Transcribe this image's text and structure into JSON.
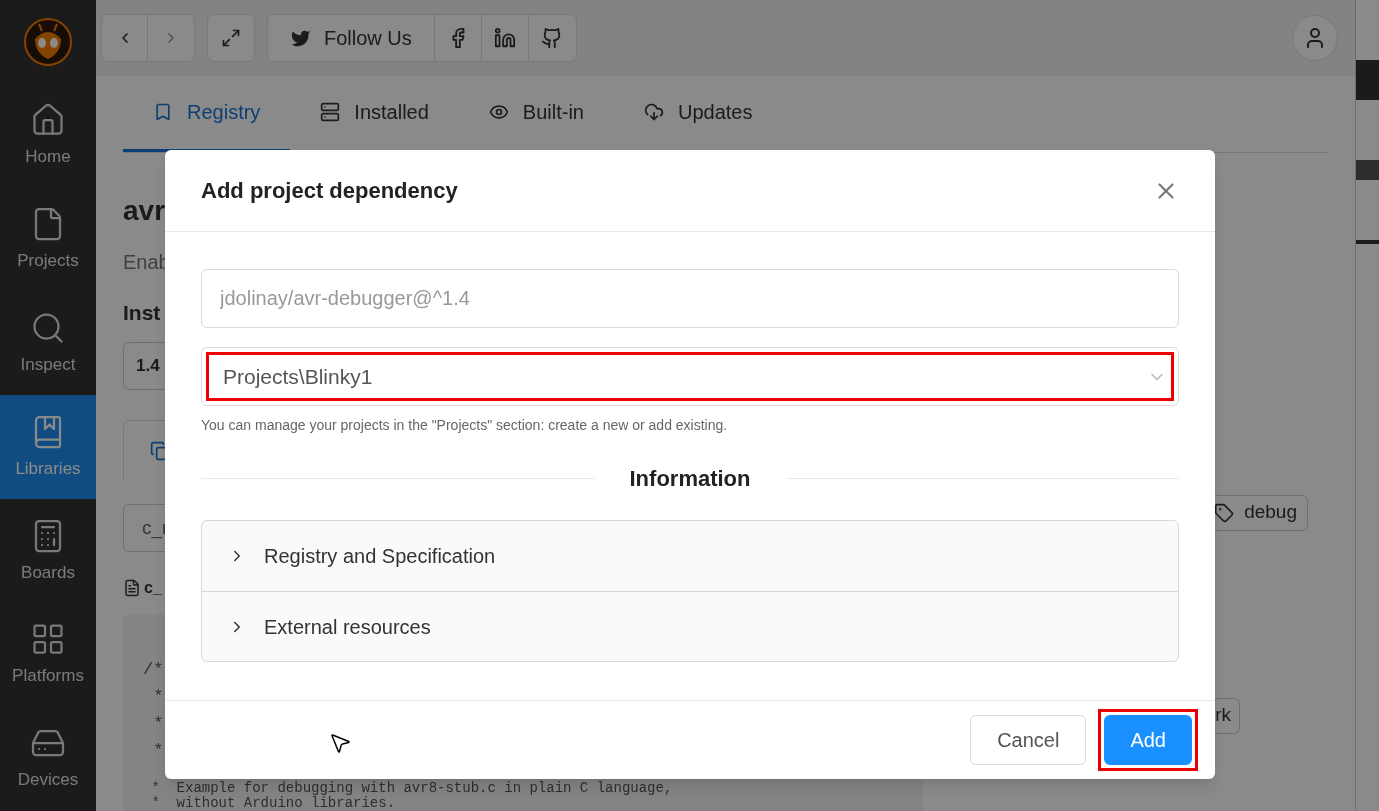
{
  "sidebar": {
    "items": [
      {
        "label": "Home",
        "selected": false
      },
      {
        "label": "Projects",
        "selected": false
      },
      {
        "label": "Inspect",
        "selected": false
      },
      {
        "label": "Libraries",
        "selected": true
      },
      {
        "label": "Boards",
        "selected": false
      },
      {
        "label": "Platforms",
        "selected": false
      },
      {
        "label": "Devices",
        "selected": false
      }
    ]
  },
  "toolbar": {
    "follow_label": "Follow Us"
  },
  "tabs": [
    {
      "label": "Registry",
      "selected": true
    },
    {
      "label": "Installed",
      "selected": false
    },
    {
      "label": "Built-in",
      "selected": false
    },
    {
      "label": "Updates",
      "selected": false
    }
  ],
  "library": {
    "title": "avr",
    "description": "Enab",
    "install_heading": "Inst",
    "version": "1.4",
    "example_select": "c_r",
    "file_name": "c_",
    "code_lines": [
      "/*",
      " *",
      " *",
      " *",
      " *  Example for debugging with avr8-stub.c in plain C language,",
      " *  without Arduino libraries."
    ],
    "tags": [
      "debug",
      "rk"
    ]
  },
  "dialog": {
    "title": "Add project dependency",
    "package_field": {
      "placeholder": "jdolinay/avr-debugger@^1.4"
    },
    "project_select": {
      "value": "Projects\\Blinky1",
      "highlighted": true
    },
    "hint": "You can manage your projects in the \"Projects\" section: create a new or add existing.",
    "section_title": "Information",
    "panels": [
      {
        "label": "Registry and Specification",
        "expanded": false
      },
      {
        "label": "External resources",
        "expanded": false
      }
    ],
    "buttons": [
      {
        "label": "Cancel",
        "kind": "default",
        "highlighted": false
      },
      {
        "label": "Add",
        "kind": "primary",
        "highlighted": true
      }
    ]
  }
}
